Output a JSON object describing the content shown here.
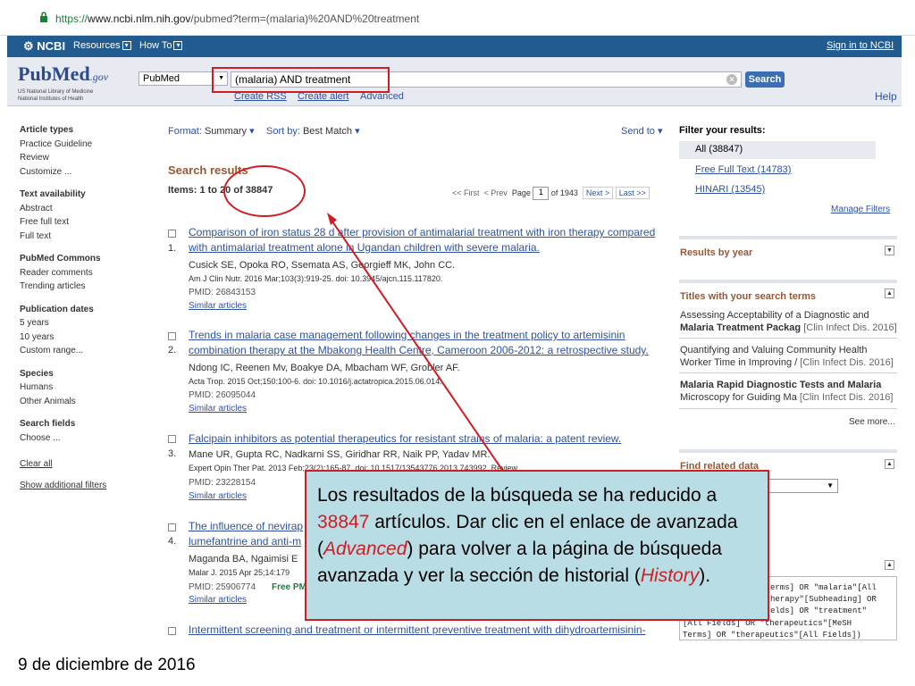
{
  "browser": {
    "url_https": "https://",
    "url_host": "www.ncbi.nlm.nih.gov",
    "url_path": "/pubmed?term=(malaria)%20AND%20treatment"
  },
  "ncbi_bar": {
    "logo": "NCBI",
    "resources": "Resources",
    "howto": "How To",
    "signin": "Sign in to NCBI"
  },
  "header": {
    "logo_pub": "Pub",
    "logo_med": "Med",
    "logo_gov": ".gov",
    "logo_sub1": "US National Library of Medicine",
    "logo_sub2": "National Institutes of Health",
    "db": "PubMed",
    "query": "(malaria) AND treatment",
    "search_btn": "Search",
    "create_rss": "Create RSS",
    "create_alert": "Create alert",
    "advanced": "Advanced",
    "help": "Help"
  },
  "left_nav": {
    "article_types": "Article types",
    "practice": "Practice Guideline",
    "review": "Review",
    "customize": "Customize ...",
    "text_avail": "Text availability",
    "abstract": "Abstract",
    "free_full": "Free full text",
    "full_text": "Full text",
    "commons": "PubMed Commons",
    "reader": "Reader comments",
    "trending": "Trending articles",
    "pubdates": "Publication dates",
    "y5": "5 years",
    "y10": "10 years",
    "custom_range": "Custom range...",
    "species": "Species",
    "humans": "Humans",
    "animals": "Other Animals",
    "fields": "Search fields",
    "choose": "Choose ...",
    "clear_all": "Clear all",
    "show_filters": "Show additional filters"
  },
  "toolbar": {
    "format_label": "Format:",
    "format": "Summary",
    "sort_label": "Sort by:",
    "sort": "Best Match",
    "sendto": "Send to"
  },
  "results": {
    "title": "Search results",
    "items": "Items: 1 to 20 of 38847",
    "pager_first": "<< First",
    "pager_prev": "< Prev",
    "pager_page": "Page",
    "pager_num": "1",
    "pager_of": "of 1943",
    "pager_next": "Next >",
    "pager_last": "Last >>",
    "list": [
      {
        "n": "1.",
        "t1": "Comparison of iron status 28 d after provision of antimalarial treatment with iron therapy compared",
        "t2": "with antimalarial treatment alone in Ugandan children with severe malaria.",
        "auth": "Cusick SE, Opoka RO, Ssemata AS, Georgieff MK, John CC.",
        "cite": "Am J Clin Nutr. 2016 Mar;103(3):919-25. doi: 10.3945/ajcn.115.117820.",
        "pmid": "PMID: 26843153",
        "sim": "Similar articles"
      },
      {
        "n": "2.",
        "t1": "Trends in malaria case management following changes in the treatment policy to artemisinin",
        "t2": "combination therapy at the Mbakong Health Centre, Cameroon 2006-2012: a retrospective study.",
        "auth": "Ndong IC, Reenen Mv, Boakye DA, Mbacham WF, Grobler AF.",
        "cite": "Acta Trop. 2015 Oct;150:100-6. doi: 10.1016/j.actatropica.2015.06.014.",
        "pmid": "PMID: 26095044",
        "sim": "Similar articles"
      },
      {
        "n": "3.",
        "t1": "Falcipain inhibitors as potential therapeutics for resistant strains of malaria: a patent review.",
        "auth": "Mane UR, Gupta RC, Nadkarni SS, Giridhar RR, Naik PP, Yadav MR.",
        "cite": "Expert Opin Ther Pat. 2013 Feb;23(2):165-87. doi: 10.1517/13543776.2013.743992. Review.",
        "pmid": "PMID: 23228154",
        "sim": "Similar articles"
      },
      {
        "n": "4.",
        "t1": "The influence of nevirap",
        "t2": "lumefantrine and anti-m",
        "auth": "Maganda BA, Ngaimisi E",
        "cite": "Malar J. 2015 Apr 25;14:179",
        "pmid": "PMID: 25906774",
        "free": "Free PM",
        "sim": "Similar articles"
      },
      {
        "t1": "Intermittent screening and treatment or intermittent preventive treatment with dihydroartemisinin-"
      }
    ]
  },
  "right": {
    "filter_title": "Filter your results:",
    "all": "All (38847)",
    "free": "Free Full Text (14783)",
    "hinari": "HINARI (13545)",
    "manage": "Manage Filters",
    "by_year": "Results by year",
    "titles_h": "Titles with your search terms",
    "t1a": "Assessing Acceptability of a Diagnostic and",
    "t1b": "Malaria Treatment Packag",
    "t1src": "[Clin Infect Dis. 2016]",
    "t2a": "Quantifying and Valuing Community Health",
    "t2b": "Worker Time in Improving /",
    "t2src": "[Clin Infect Dis. 2016]",
    "t3a": "Malaria Rapid Diagnostic Tests and Malaria",
    "t3b": "Microscopy for Guiding Ma",
    "t3src": "[Clin Infect Dis. 2016]",
    "see_more": "See more...",
    "related_h": "Find related data",
    "details1": "erms] OR \"malaria\"[All",
    "details2": "herapy\"[Subheading] OR",
    "details3": "elds] OR \"treatment\"",
    "details4": "[All Fields] OR \"therapeutics\"[MeSH",
    "details5": "Terms] OR \"therapeutics\"[All Fields])"
  },
  "callout": {
    "p1": "Los resultados de la búsqueda se ha reducido a ",
    "num": "38847",
    "p2": " artículos. Dar clic en el enlace de avanzada (",
    "adv": "Advanced",
    "p3": ") para volver a la página de búsqueda avanzada y ver la sección de historial (",
    "hist": "History",
    "p4": ")."
  },
  "footer_date": "9 de diciembre de 2016",
  "colors": {
    "accent_red": "#d01c22",
    "link": "#2f52a0",
    "ncbi_bar": "#215b8f",
    "callout_bg": "#b9dde4"
  }
}
